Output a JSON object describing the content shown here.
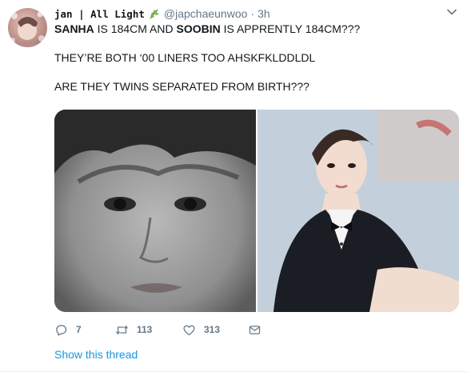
{
  "tweet": {
    "author": {
      "display_name": "jan | All Light",
      "emoji_icon": "herb-icon",
      "handle": "@japchaeunwoo",
      "separator": "·",
      "time": "3h"
    },
    "text": {
      "line1": {
        "name1": "SANHA",
        "part1": " IS 184CM AND ",
        "name2": "SOOBIN",
        "part2": " IS APPRENTLY 184CM???"
      },
      "line2": "THEY’RE BOTH ‘00 LINERS TOO AHSKFKLDDLDL",
      "line3": "ARE THEY TWINS SEPARATED FROM BIRTH???"
    },
    "media": [
      {
        "name": "photo-left",
        "style": "grayscale portrait"
      },
      {
        "name": "photo-right",
        "style": "color portrait in tuxedo"
      }
    ],
    "actions": {
      "reply_count": "7",
      "retweet_count": "113",
      "like_count": "313"
    },
    "show_thread_label": "Show this thread"
  },
  "colors": {
    "link": "#1b95e0",
    "muted": "#657786",
    "text": "#14171a"
  }
}
